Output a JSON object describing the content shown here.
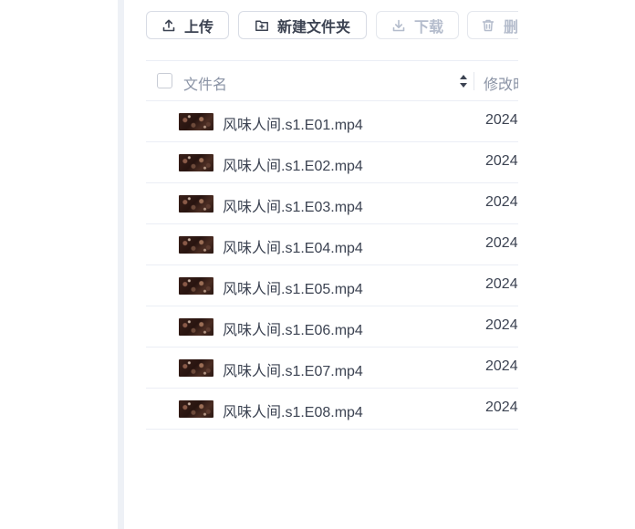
{
  "toolbar": {
    "upload_label": "上传",
    "new_folder_label": "新建文件夹",
    "download_label": "下载",
    "delete_label": "删"
  },
  "table": {
    "header": {
      "name_label": "文件名",
      "modified_label": "修改时"
    },
    "rows": [
      {
        "name": "风味人间.s1.E01.mp4",
        "modified": "2024"
      },
      {
        "name": "风味人间.s1.E02.mp4",
        "modified": "2024"
      },
      {
        "name": "风味人间.s1.E03.mp4",
        "modified": "2024"
      },
      {
        "name": "风味人间.s1.E04.mp4",
        "modified": "2024"
      },
      {
        "name": "风味人间.s1.E05.mp4",
        "modified": "2024"
      },
      {
        "name": "风味人间.s1.E06.mp4",
        "modified": "2024"
      },
      {
        "name": "风味人间.s1.E07.mp4",
        "modified": "2024"
      },
      {
        "name": "风味人间.s1.E08.mp4",
        "modified": "2024"
      }
    ]
  },
  "colors": {
    "text": "#3c4352",
    "muted": "#8a93a5",
    "disabled": "#b4bccc",
    "border": "#d8dce5",
    "divider": "#ebeef5",
    "sidebar_strip": "#eef1f6"
  },
  "icons": {
    "upload": "upload-icon",
    "new_folder": "folder-plus-icon",
    "download": "download-icon",
    "delete": "trash-icon",
    "sort": "sort-icon",
    "thumbnail": "video-thumbnail"
  }
}
